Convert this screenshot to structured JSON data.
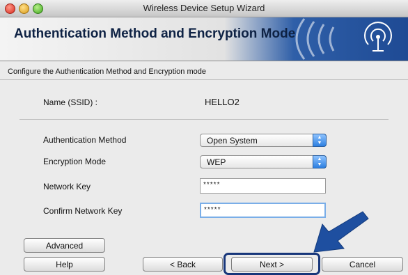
{
  "window": {
    "title": "Wireless Device Setup Wizard"
  },
  "header": {
    "title": "Authentication Method and Encryption Mode",
    "logo_icon": "wireless-signal-icon"
  },
  "instruction": "Configure the Authentication Method and Encryption mode",
  "ssid": {
    "label": "Name (SSID) :",
    "value": "HELLO2"
  },
  "auth": {
    "label": "Authentication Method",
    "selected": "Open System"
  },
  "encryption": {
    "label": "Encryption Mode",
    "selected": "WEP"
  },
  "network_key": {
    "label": "Network Key",
    "value": "*****"
  },
  "confirm_key": {
    "label": "Confirm Network Key",
    "value": "*****"
  },
  "buttons": {
    "advanced": "Advanced",
    "help": "Help",
    "back": "< Back",
    "next": "Next >",
    "cancel": "Cancel"
  },
  "annotation": {
    "arrow_icon": "pointer-arrow-icon",
    "arrow_color": "#1e4fa0"
  }
}
